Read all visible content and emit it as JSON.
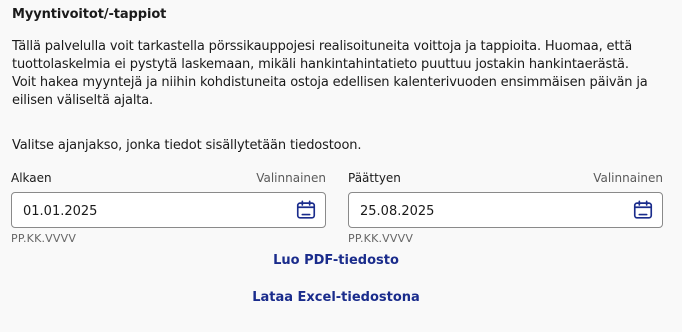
{
  "section": {
    "title": "Myyntivoitot/-tappiot",
    "description": "Tällä palvelulla voit tarkastella pörssikauppojesi realisoituneita voittoja ja tappioita. Huomaa, että tuottolaskelmia ei pystytä laskemaan, mikäli hankintahintatieto puuttuu jostakin hankintaerästä. Voit hakea myyntejä ja niihin kohdistuneita ostoja edellisen kalenterivuoden ensimmäisen päivän ja eilisen väliseltä ajalta.",
    "period_prompt": "Valitse ajanjakso, jonka tiedot sisällytetään tiedostoon."
  },
  "start_date": {
    "label": "Alkaen",
    "optional": "Valinnainen",
    "value": "01.01.2025",
    "format_hint": "PP.KK.VVVV",
    "icon": "calendar-icon"
  },
  "end_date": {
    "label": "Päättyen",
    "optional": "Valinnainen",
    "value": "25.08.2025",
    "format_hint": "PP.KK.VVVV",
    "icon": "calendar-icon"
  },
  "actions": {
    "pdf_label": "Luo PDF-tiedosto",
    "excel_label": "Lataa Excel-tiedostona"
  },
  "colors": {
    "background": "#f9f9f9",
    "link": "#1a2c8c",
    "icon": "#1a2c8c",
    "border": "#8a8a8a"
  }
}
